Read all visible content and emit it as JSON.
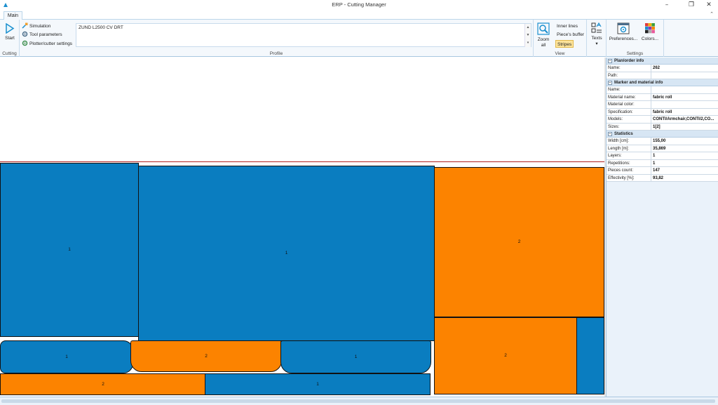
{
  "window": {
    "title": "ERP - Cutting Manager"
  },
  "tabs": [
    {
      "label": "Main"
    }
  ],
  "ribbon": {
    "cutting": {
      "label": "Cutting",
      "start_label": "Start"
    },
    "profile": {
      "label": "Profile",
      "simulation_label": "Simulation",
      "tool_parameters_label": "Tool parameters",
      "plotter_settings_label": "Plotter/cutter settings",
      "selected_profile": "ZUND L2500 CV DRT"
    },
    "view": {
      "label": "View",
      "zoom_all_label_1": "Zoom",
      "zoom_all_label_2": "all",
      "inner_lines_label": "Inner lines",
      "pieces_buffer_label": "Piece's buffer",
      "stripes_label": "Stripes",
      "texts_label": "Texts"
    },
    "settings": {
      "label": "Settings",
      "preferences_label": "Preferences...",
      "colors_label": "Colors..."
    }
  },
  "canvas": {
    "pieces": [
      {
        "label": "1",
        "color": "blue"
      },
      {
        "label": "1",
        "color": "blue"
      },
      {
        "label": "2",
        "color": "orange"
      },
      {
        "label": "2",
        "color": "orange"
      },
      {
        "label": "",
        "color": "blue"
      },
      {
        "label": "1",
        "color": "blue"
      },
      {
        "label": "2",
        "color": "orange"
      },
      {
        "label": "1",
        "color": "blue"
      },
      {
        "label": "2",
        "color": "orange"
      },
      {
        "label": "1",
        "color": "blue"
      }
    ]
  },
  "info_panel": {
    "sections": [
      {
        "title": "Plan/order info",
        "rows": [
          {
            "key": "Name:",
            "value": "262"
          },
          {
            "key": "Path:",
            "value": ""
          }
        ]
      },
      {
        "title": "Marker and material info",
        "rows": [
          {
            "key": "Name:",
            "value": ""
          },
          {
            "key": "Material name:",
            "value": "fabric roll"
          },
          {
            "key": "Material color:",
            "value": ""
          },
          {
            "key": "Specification:",
            "value": "fabric roll"
          },
          {
            "key": "Models:",
            "value": "CONTI/Armchair,CONTI/2,CO..."
          },
          {
            "key": "Sizes:",
            "value": "1[2]"
          }
        ]
      },
      {
        "title": "Statistics",
        "rows": [
          {
            "key": "Width [cm]:",
            "value": "155,00"
          },
          {
            "key": "Length [m]:",
            "value": "35,869"
          },
          {
            "key": "Layers:",
            "value": "1"
          },
          {
            "key": "Repetitions:",
            "value": "1"
          },
          {
            "key": "Pieces count:",
            "value": "147"
          },
          {
            "key": "Effectivity [%]:",
            "value": "93,82"
          }
        ]
      }
    ]
  },
  "colors": {
    "blue_piece": "#0a7dc0",
    "orange_piece": "#fc8300",
    "accent": "#1a8fcf"
  }
}
